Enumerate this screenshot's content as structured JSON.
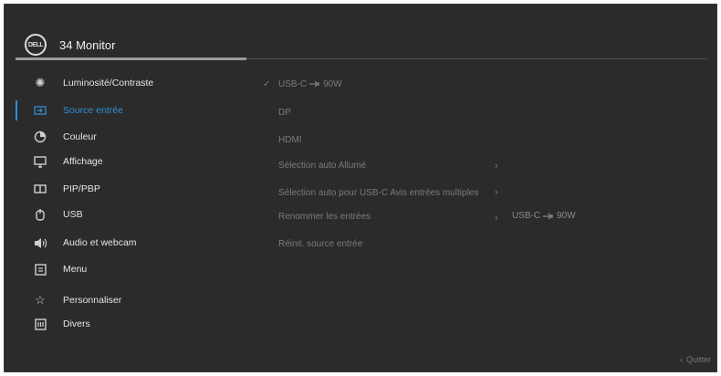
{
  "header": {
    "logo_text": "DELL",
    "title": "34 Monitor"
  },
  "sidebar": {
    "items": [
      {
        "label": "Luminosité/Contraste",
        "icon": "brightness-icon"
      },
      {
        "label": "Source entrée",
        "icon": "input-source-icon",
        "active": true
      },
      {
        "label": "Couleur",
        "icon": "color-icon"
      },
      {
        "label": "Affichage",
        "icon": "display-icon"
      },
      {
        "label": "PIP/PBP",
        "icon": "pip-pbp-icon"
      },
      {
        "label": "USB",
        "icon": "usb-icon"
      },
      {
        "label": "Audio et webcam",
        "icon": "audio-icon"
      },
      {
        "label": "Menu",
        "icon": "menu-icon"
      },
      {
        "label": "Personnaliser",
        "icon": "star-icon"
      },
      {
        "label": "Divers",
        "icon": "misc-icon"
      }
    ]
  },
  "options": {
    "usbc_prefix": "USB-C",
    "usbc_suffix": "90W",
    "dp": "DP",
    "hdmi": "HDMI",
    "auto_select": "Sélection auto Allumé",
    "auto_select_usbc": "Sélection auto pour USB-C  Avis entrées multiples",
    "rename_inputs": "Renommer les entrées",
    "reset_source": "Réinit. source entrée"
  },
  "submenu": {
    "usbc_prefix": "USB-C",
    "usbc_suffix": "90W"
  },
  "footer": {
    "quit_label": "Quitter"
  },
  "colors": {
    "accent": "#2f8fd6",
    "background": "#2b2b2b"
  }
}
